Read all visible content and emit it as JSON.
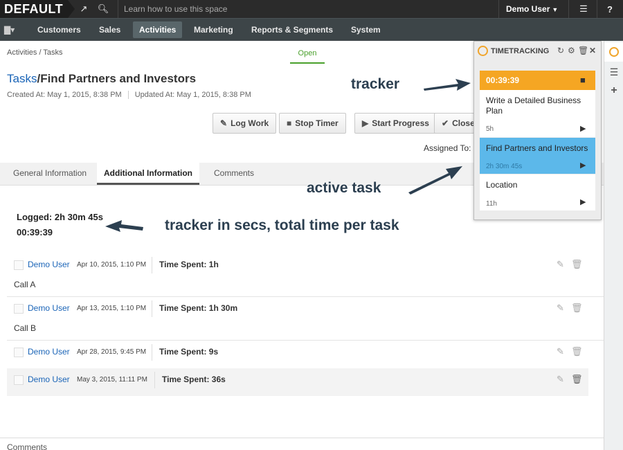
{
  "topbar": {
    "logo": "DEFAULT",
    "search_placeholder": "Learn how to use this space",
    "user": "Demo User"
  },
  "nav": {
    "items": [
      "Customers",
      "Sales",
      "Activities",
      "Marketing",
      "Reports & Segments",
      "System"
    ],
    "active": "Activities"
  },
  "breadcrumb": "Activities / Tasks",
  "status": "Open",
  "title": {
    "link": "Tasks",
    "separator": "/",
    "name": "Find Partners and Investors"
  },
  "meta": {
    "created": "Created At: May 1, 2015, 8:38 PM",
    "updated": "Updated At: May 1, 2015, 8:38 PM"
  },
  "actions": {
    "log_work": "Log Work",
    "stop_timer": "Stop Timer",
    "start_progress": "Start Progress",
    "close": "Close"
  },
  "assigned_label": "Assigned To:",
  "tabs": [
    "General Information",
    "Additional Information",
    "Comments"
  ],
  "active_tab": "Additional Information",
  "logged": {
    "total": "Logged: 2h 30m 45s",
    "timer": "00:39:39"
  },
  "entries": [
    {
      "user": "Demo User",
      "date": "Apr 10, 2015, 1:10 PM",
      "time_spent": "Time Spent: 1h",
      "note": "Call A"
    },
    {
      "user": "Demo User",
      "date": "Apr 13, 2015, 1:10 PM",
      "time_spent": "Time Spent: 1h 30m",
      "note": "Call B"
    },
    {
      "user": "Demo User",
      "date": "Apr 28, 2015, 9:45 PM",
      "time_spent": "Time Spent: 9s",
      "note": ""
    },
    {
      "user": "Demo User",
      "date": "May 3, 2015, 11:11 PM",
      "time_spent": "Time Spent: 36s",
      "note": ""
    }
  ],
  "comments_footer": "Comments",
  "timetracking": {
    "title": "TIMETRACKING",
    "timer": "00:39:39",
    "tasks": [
      {
        "name": "Write a Detailed Business Plan",
        "duration": "5h"
      },
      {
        "name": "Find Partners and Investors",
        "duration": "2h 30m 45s"
      },
      {
        "name": "Location",
        "duration": "11h"
      }
    ]
  },
  "annotations": {
    "tracker": "tracker",
    "active_task": "active task",
    "tracker_secs": "tracker in secs, total time per task"
  },
  "colors": {
    "accent_orange": "#f5a623",
    "active_blue": "#5cb8ea",
    "link_blue": "#1a64b7",
    "nav_bg": "#3d4548",
    "status_green": "#4aa02c"
  }
}
